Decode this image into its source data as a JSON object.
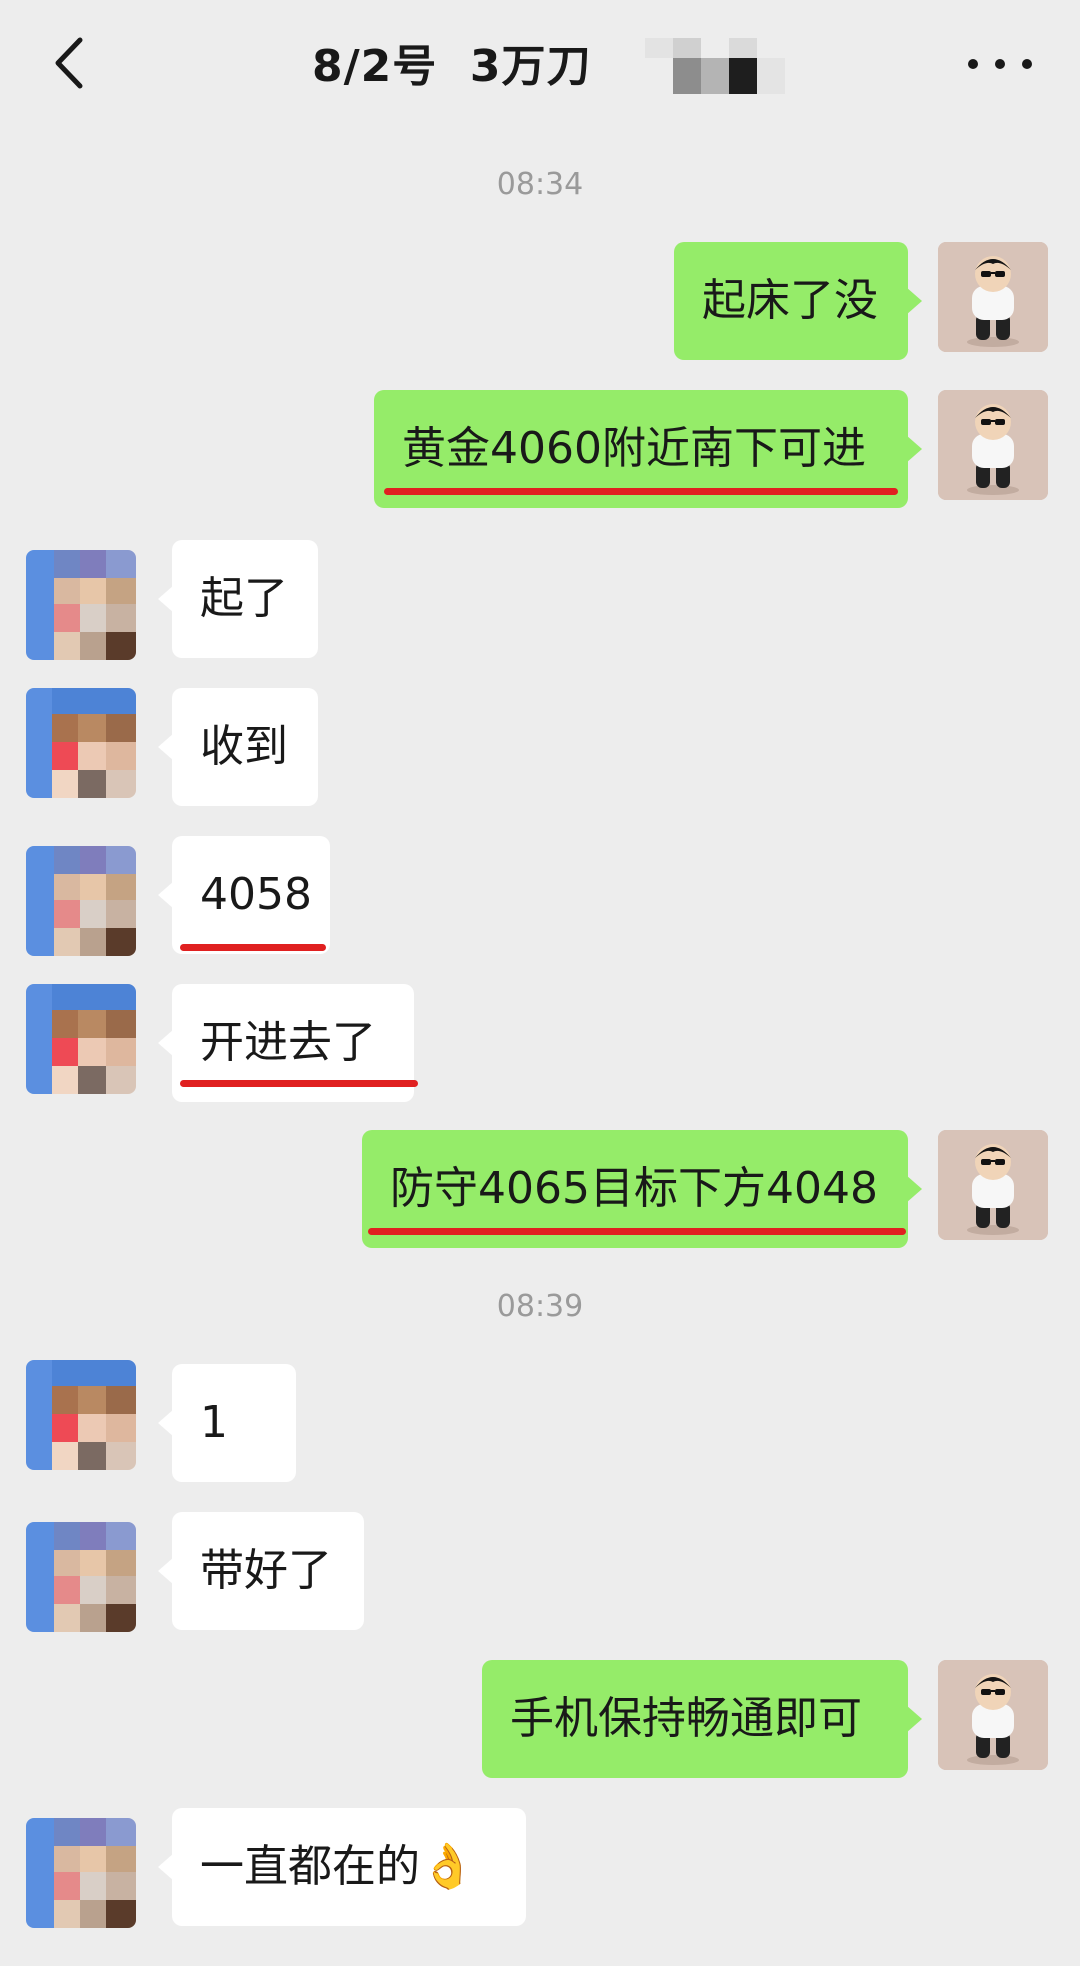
{
  "header": {
    "title": "8/2号  3万刀",
    "back_icon": "chevron-left-icon",
    "more_icon": "more-horizontal-icon"
  },
  "timestamps": [
    "08:34",
    "08:39"
  ],
  "messages": [
    {
      "dir": "out",
      "text": "起床了没",
      "underlined": false
    },
    {
      "dir": "out",
      "text": "黄金4060附近南下可进",
      "underlined": true
    },
    {
      "dir": "in",
      "text": "起了",
      "underlined": false
    },
    {
      "dir": "in",
      "text": "收到",
      "underlined": false
    },
    {
      "dir": "in",
      "text": "4058",
      "underlined": true
    },
    {
      "dir": "in",
      "text": "开进去了",
      "underlined": true
    },
    {
      "dir": "out",
      "text": "防守4065目标下方4048",
      "underlined": true
    },
    {
      "dir": "in",
      "text": "1",
      "underlined": false
    },
    {
      "dir": "in",
      "text": "带好了",
      "underlined": false
    },
    {
      "dir": "out",
      "text": "手机保持畅通即可",
      "underlined": false
    },
    {
      "dir": "in",
      "text": "一直都在的👌",
      "underlined": false
    }
  ],
  "colors": {
    "background": "#ededed",
    "outgoing_bubble": "#95ec69",
    "incoming_bubble": "#ffffff",
    "annotation_underline": "#e02020",
    "timestamp_text": "#9a9a9a"
  }
}
